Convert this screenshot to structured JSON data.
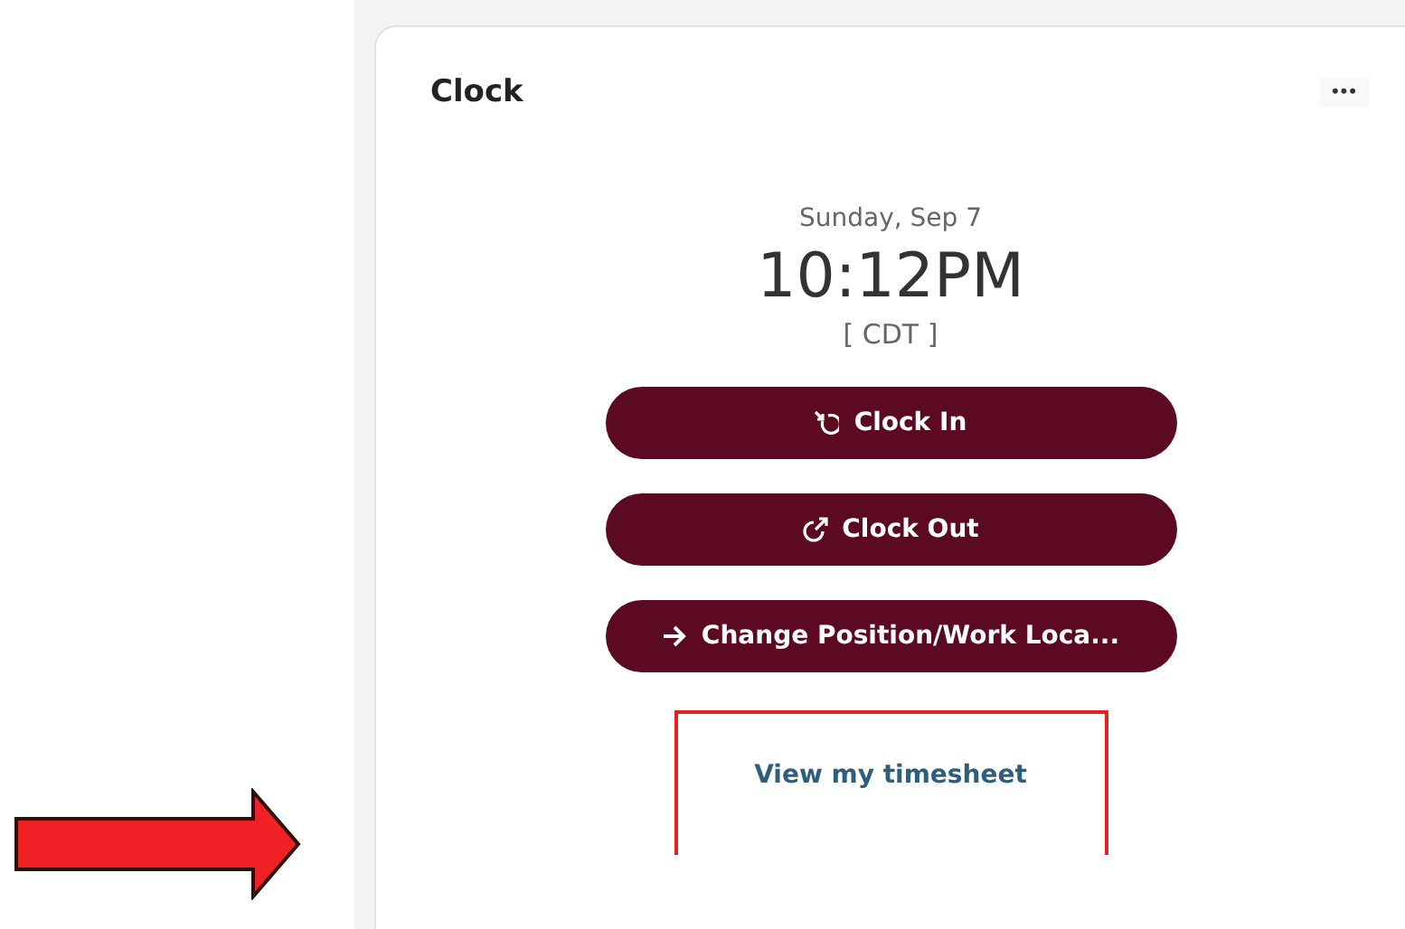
{
  "card": {
    "title": "Clock",
    "menu": "•••",
    "date": "Sunday, Sep 7",
    "time": "10:12PM",
    "timezone": "[ CDT ]",
    "buttons": [
      {
        "label": "Clock In",
        "kind": "clock-in"
      },
      {
        "label": "Clock Out",
        "kind": "clock-out"
      },
      {
        "label": "Change Position/Work Loca...",
        "kind": "arrow"
      }
    ],
    "link": "View my timesheet"
  }
}
